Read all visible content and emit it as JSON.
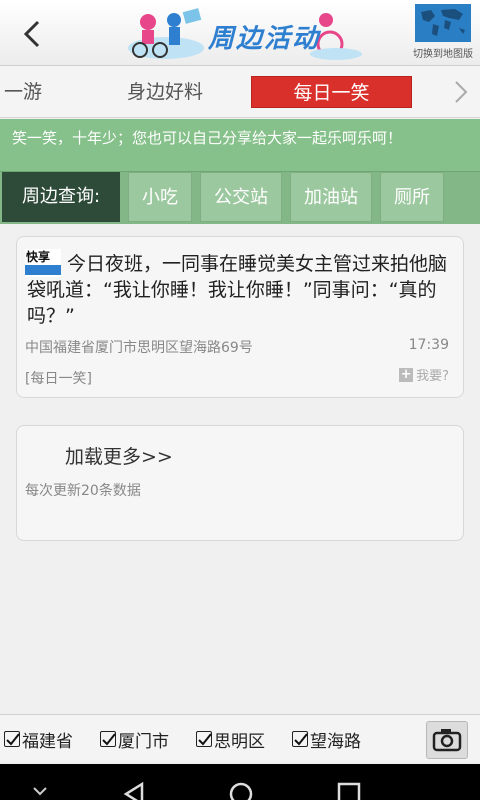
{
  "header": {
    "title": "周边活动",
    "map_switch_label": "切换到地图版"
  },
  "tabs": [
    {
      "label": "一游",
      "active": false
    },
    {
      "label": "身边好料",
      "active": false
    },
    {
      "label": "每日一笑",
      "active": true
    }
  ],
  "info": {
    "text": "笑一笑，十年少；您也可以自己分享给大家一起乐呵乐呵！"
  },
  "query": {
    "label": "周边查询:",
    "buttons": [
      "小吃",
      "公交站",
      "加油站",
      "厕所"
    ]
  },
  "news": {
    "text": "今日夜班，一同事在睡觉美女主管过来拍他脑袋吼道：“我让你睡！我让你睡！”同事问：“真的吗？”",
    "location": "中国福建省厦门市思明区望海路69号",
    "time": "17:39",
    "tag": "[每日一笑]",
    "report_label": "我要?"
  },
  "load_more": {
    "label": "加载更多>>",
    "note": "每次更新20条数据"
  },
  "address": {
    "items": [
      "福建省",
      "厦门市",
      "思明区",
      "望海路"
    ]
  },
  "colors": {
    "accent_red": "#d9302c",
    "info_green": "#86c08a",
    "query_dark": "#2e4b3a"
  }
}
